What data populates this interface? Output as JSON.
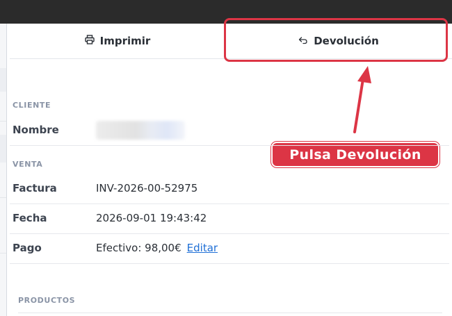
{
  "tabs": {
    "print_label": "Imprimir",
    "return_label": "Devolución"
  },
  "annotation": {
    "callout_text": "Pulsa Devolución",
    "accent_color": "#dc3545"
  },
  "customer": {
    "section_title": "CLIENTE",
    "name_label": "Nombre"
  },
  "sale": {
    "section_title": "VENTA",
    "invoice_label": "Factura",
    "invoice_value": "INV-2026-00-52975",
    "date_label": "Fecha",
    "date_value": "2026-09-01 19:43:42",
    "payment_label": "Pago",
    "payment_value": "Efectivo: 98,00€",
    "edit_link": "Editar"
  },
  "products": {
    "section_title": "PRODUCTOS"
  },
  "icons": {
    "print": "printer-icon",
    "return": "undo-arrow-icon"
  }
}
